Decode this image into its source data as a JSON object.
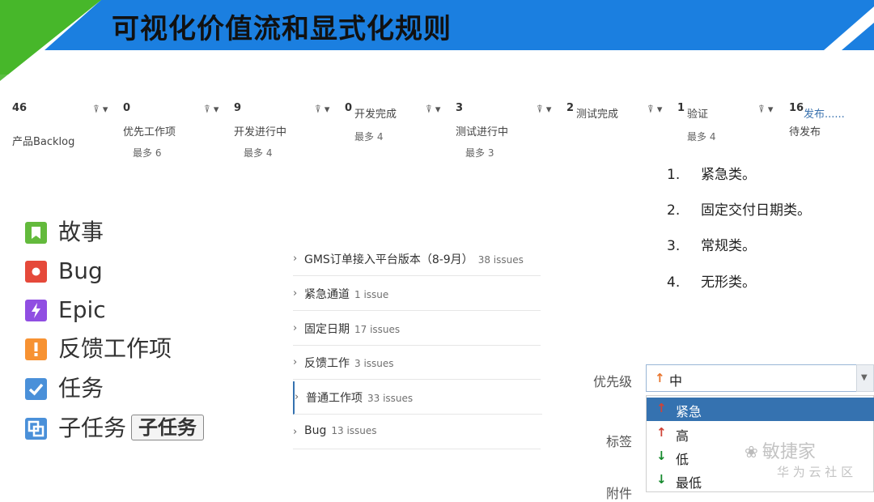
{
  "slide": {
    "title": "可视化价值流和显式化规则"
  },
  "board": {
    "columns": [
      {
        "count": "46",
        "name": "产品Backlog",
        "max": ""
      },
      {
        "count": "0",
        "name": "优先工作项",
        "max": "最多 6"
      },
      {
        "count": "9",
        "name": "开发进行中",
        "max": "最多 4"
      },
      {
        "count": "0",
        "name": "开发完成",
        "max": "最多 4"
      },
      {
        "count": "3",
        "name": "测试进行中",
        "max": "最多 3"
      },
      {
        "count": "2",
        "name": "测试完成",
        "max": ""
      },
      {
        "count": "1",
        "name": "验证",
        "max": "最多 4"
      },
      {
        "count": "16",
        "name": "待发布",
        "link": "发布......"
      }
    ],
    "filter_icon": "filter-dropdown-icon"
  },
  "issue_types": [
    {
      "label": "故事",
      "icon": "story-icon",
      "color": "#63ba3c"
    },
    {
      "label": "Bug",
      "icon": "bug-icon",
      "color": "#e5493a"
    },
    {
      "label": "Epic",
      "icon": "epic-icon",
      "color": "#904ee2"
    },
    {
      "label": "反馈工作项",
      "icon": "feedback-icon",
      "color": "#f79232"
    },
    {
      "label": "任务",
      "icon": "task-icon",
      "color": "#4a90d9"
    },
    {
      "label": "子任务",
      "icon": "subtask-icon",
      "color": "#4a90d9",
      "badge": "子任务"
    }
  ],
  "swimlanes": [
    {
      "name": "GMS订单接入平台版本（8-9月）",
      "count": "38 issues"
    },
    {
      "name": "紧急通道",
      "count": "1 issue"
    },
    {
      "name": "固定日期",
      "count": "17 issues"
    },
    {
      "name": "反馈工作",
      "count": "3 issues"
    },
    {
      "name": "普通工作项",
      "count": "33 issues"
    },
    {
      "name": "Bug",
      "count": "13 issues"
    }
  ],
  "class_of_service": [
    {
      "num": "1.",
      "text": "紧急类。"
    },
    {
      "num": "2.",
      "text": "固定交付日期类。"
    },
    {
      "num": "3.",
      "text": "常规类。"
    },
    {
      "num": "4.",
      "text": "无形类。"
    }
  ],
  "priority_field": {
    "label": "优先级",
    "value": "中",
    "labels_label": "标签",
    "attachments_label": "附件",
    "options": [
      {
        "text": "紧急",
        "dir": "↑",
        "color": "#d04437",
        "selected": true
      },
      {
        "text": "高",
        "dir": "↑",
        "color": "#d04437",
        "selected": false
      },
      {
        "text": "低",
        "dir": "↓",
        "color": "#14892c",
        "selected": false
      },
      {
        "text": "最低",
        "dir": "↓",
        "color": "#14892c",
        "selected": false
      }
    ]
  },
  "watermark": {
    "name": "敏捷家",
    "sub": "华 为 云 社 区"
  },
  "colors": {
    "banner_blue": "#1b7fe0",
    "banner_green": "#47b72a"
  }
}
